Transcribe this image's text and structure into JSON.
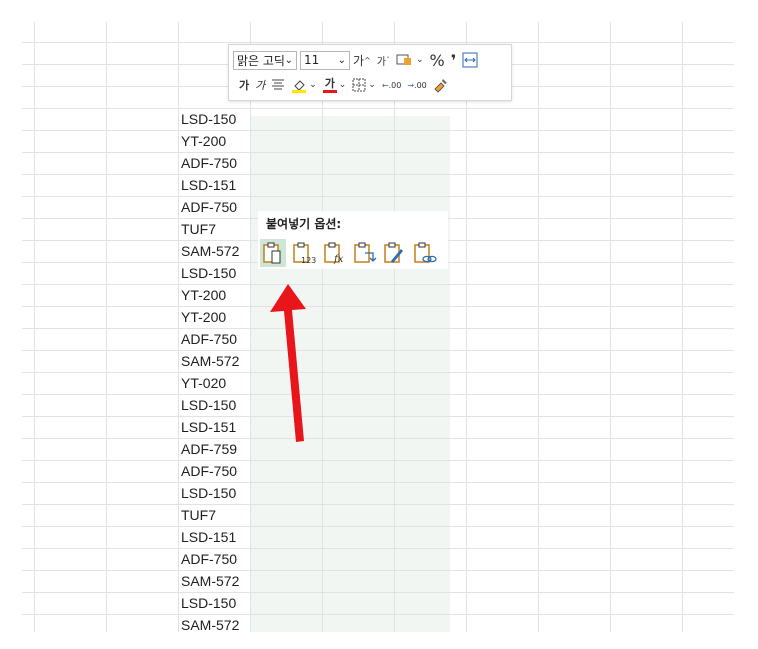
{
  "toolbar": {
    "font_name": "맑은 고딕",
    "font_size": "11",
    "increase_font": "가",
    "decrease_font": "가",
    "percent": "%",
    "comma": "❜",
    "bold": "가",
    "italic": "가",
    "font_color_letter": "가",
    "increase_decimal": ".00",
    "decrease_decimal": ".00",
    "chevron": "⌄"
  },
  "paste_options": {
    "title": "붙여넣기 옵션:",
    "items": [
      "paste",
      "values",
      "formulas",
      "transpose",
      "formatting",
      "paste-link"
    ]
  },
  "cells": [
    "LSD-150",
    "YT-200",
    "ADF-750",
    "LSD-151",
    "ADF-750",
    "TUF7",
    "SAM-572",
    "LSD-150",
    "YT-200",
    "YT-200",
    "ADF-750",
    "SAM-572",
    "YT-020",
    "LSD-150",
    "LSD-151",
    "ADF-759",
    "ADF-750",
    "LSD-150",
    "TUF7",
    "LSD-151",
    "ADF-750",
    "SAM-572",
    "LSD-150",
    "SAM-572"
  ],
  "colors": {
    "gridline": "#e2e2e2",
    "selection": "#f2f6f3",
    "arrow": "#e8151b",
    "clipboard": "#c47f1a",
    "active_paste": "#cde6d6"
  }
}
